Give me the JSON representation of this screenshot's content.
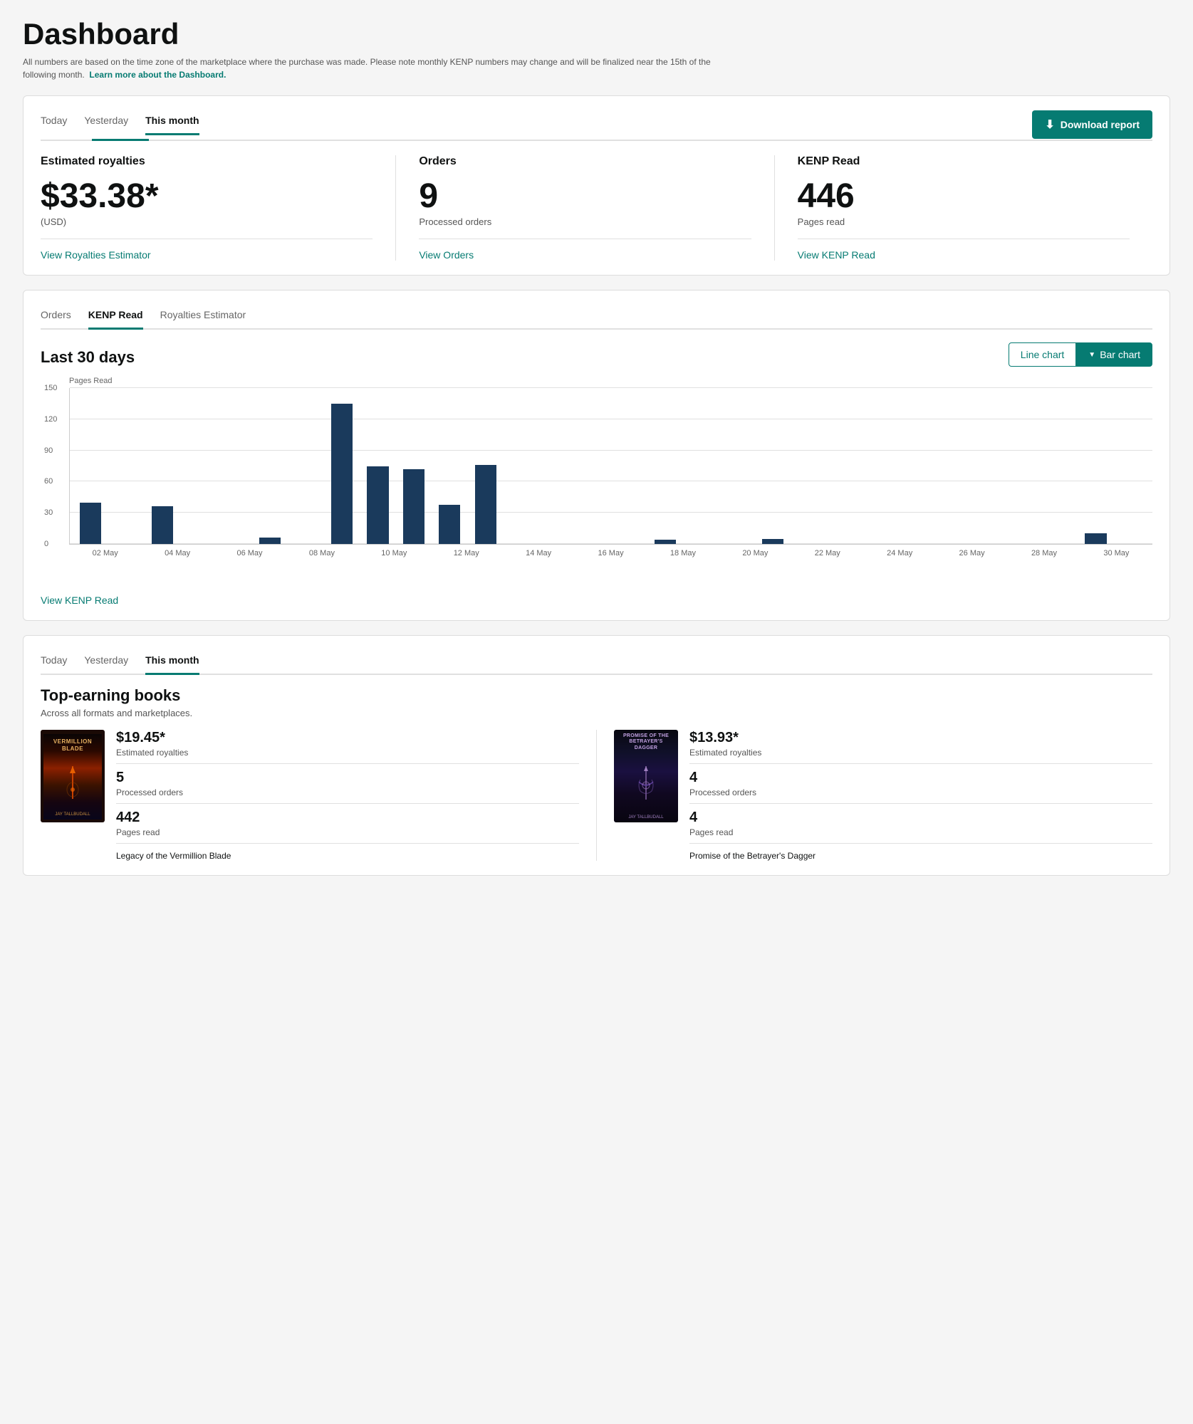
{
  "page": {
    "title": "Dashboard",
    "subtitle": "All numbers are based on the time zone of the marketplace where the purchase was made. Please note monthly KENP numbers may change and will be finalized near the 15th of the following month.",
    "learn_more_text": "Learn more about the Dashboard.",
    "accent_color": "#067b72",
    "bar_color": "#1a3a5c"
  },
  "stats_card": {
    "tabs": [
      "Today",
      "Yesterday",
      "This month"
    ],
    "active_tab": "This month",
    "download_button": "Download report",
    "royalties": {
      "label": "Estimated royalties",
      "value": "$33.38*",
      "sublabel": "(USD)",
      "link": "View Royalties Estimator"
    },
    "orders": {
      "label": "Orders",
      "value": "9",
      "sublabel": "Processed orders",
      "link": "View Orders"
    },
    "kenp": {
      "label": "KENP Read",
      "value": "446",
      "sublabel": "Pages read",
      "link": "View KENP Read"
    }
  },
  "chart_card": {
    "tabs": [
      "Orders",
      "KENP Read",
      "Royalties Estimator"
    ],
    "active_tab": "KENP Read",
    "title": "Last 30 days",
    "chart_y_label": "Pages Read",
    "line_chart_label": "Line chart",
    "bar_chart_label": "Bar chart",
    "view_link": "View KENP Read",
    "y_ticks": [
      "0",
      "30",
      "60",
      "90",
      "120",
      "150"
    ],
    "x_labels": [
      "02 May",
      "04 May",
      "06 May",
      "08 May",
      "10 May",
      "12 May",
      "14 May",
      "16 May",
      "18 May",
      "20 May",
      "22 May",
      "24 May",
      "26 May",
      "28 May",
      "30 May"
    ],
    "bar_data": [
      40,
      0,
      36,
      0,
      0,
      6,
      0,
      135,
      75,
      72,
      38,
      76,
      0,
      0,
      0,
      0,
      4,
      0,
      0,
      5,
      0,
      0,
      0,
      0,
      0,
      0,
      0,
      0,
      10,
      0
    ]
  },
  "books_card": {
    "tabs": [
      "Today",
      "Yesterday",
      "This month"
    ],
    "active_tab": "This month",
    "section_title": "Top-earning books",
    "section_subtitle": "Across all formats and marketplaces.",
    "books": [
      {
        "royalty": "$19.45*",
        "royalty_label": "Estimated royalties",
        "orders_value": "5",
        "orders_label": "Processed orders",
        "pages_value": "442",
        "pages_label": "Pages read",
        "title": "Legacy of the Vermillion Blade",
        "cover_type": "vermillion",
        "cover_title": "VERMILLION BLADE",
        "cover_subtitle": "JAY TALLBUDALL"
      },
      {
        "royalty": "$13.93*",
        "royalty_label": "Estimated royalties",
        "orders_value": "4",
        "orders_label": "Processed orders",
        "pages_value": "4",
        "pages_label": "Pages read",
        "title": "Promise of the Betrayer's Dagger",
        "cover_type": "betrayers",
        "cover_title": "PROMISE OF THE BETRAYER'S DAGGER",
        "cover_subtitle": "JAY TALLBUDALL"
      }
    ]
  }
}
